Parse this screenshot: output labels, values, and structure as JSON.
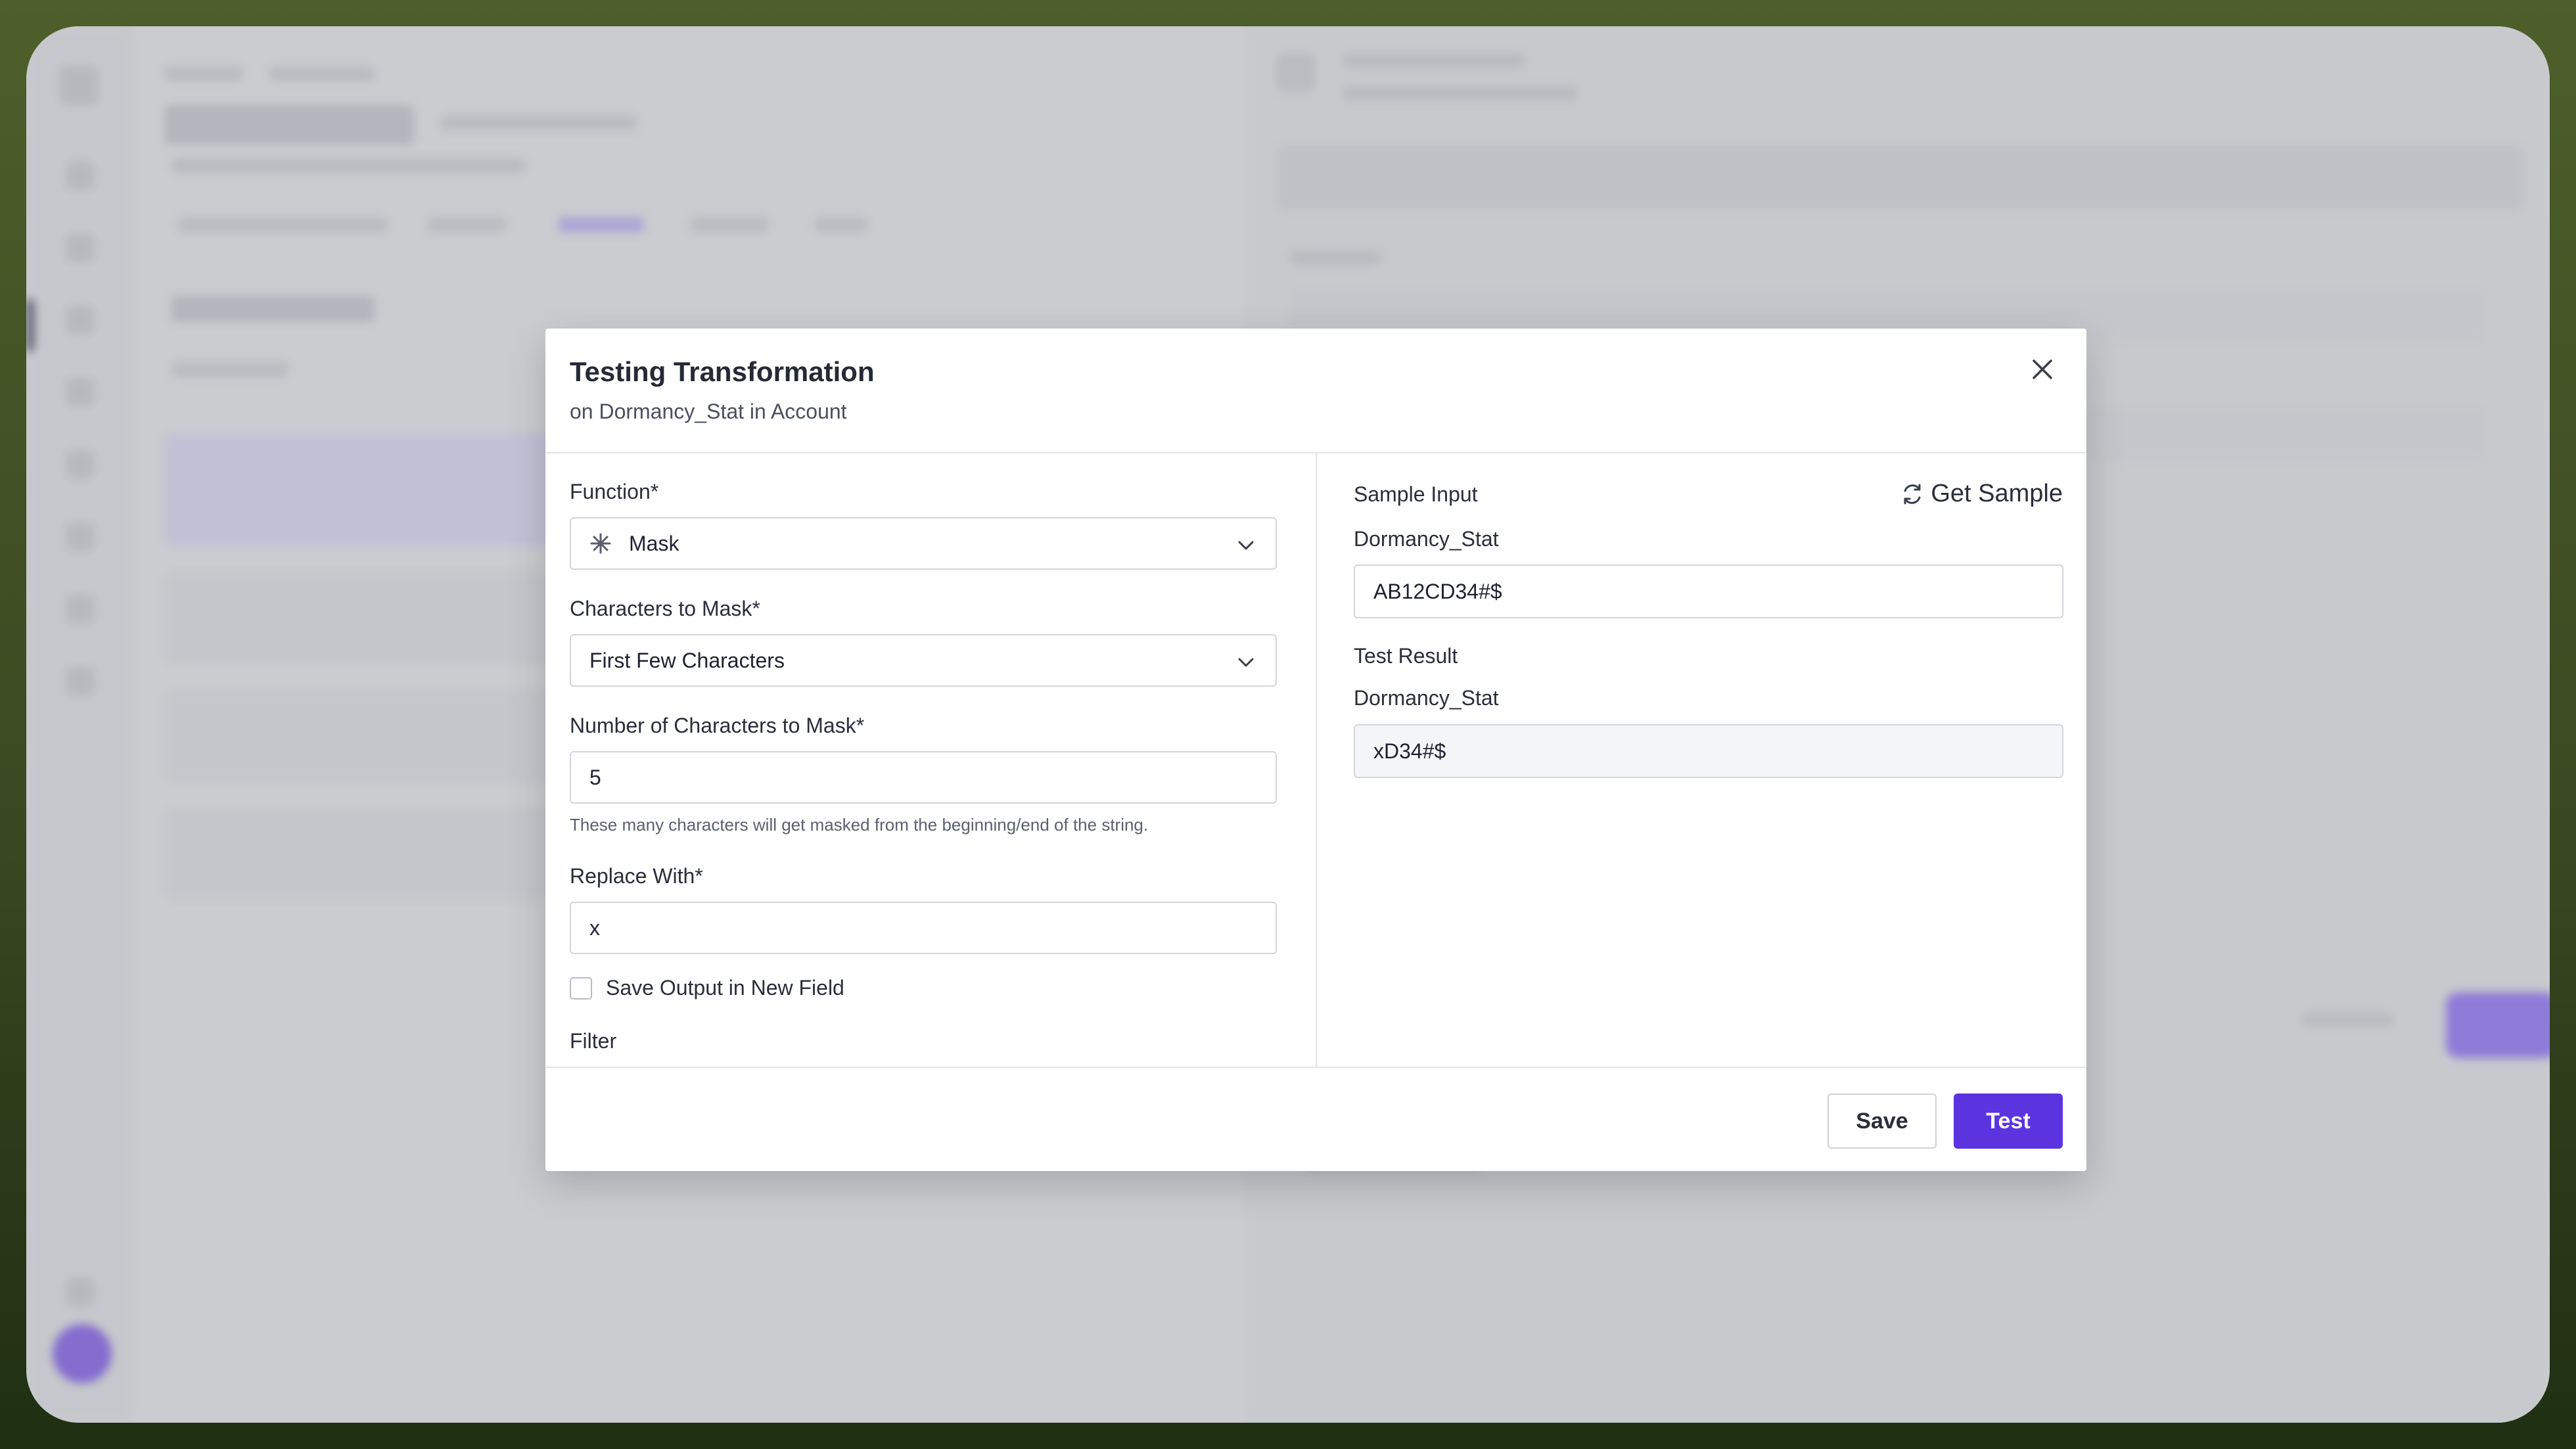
{
  "modal": {
    "title": "Testing Transformation",
    "subtitle": "on Dormancy_Stat in Account",
    "left": {
      "function_label": "Function*",
      "function_value": "Mask",
      "function_icon": "asterisk-icon",
      "chars_to_mask_label": "Characters to Mask*",
      "chars_to_mask_value": "First Few Characters",
      "num_chars_label": "Number of Characters to Mask*",
      "num_chars_value": "5",
      "num_chars_helper": "These many characters will get masked from the beginning/end of the string.",
      "replace_with_label": "Replace With*",
      "replace_with_value": "x",
      "save_output_label": "Save Output in New Field",
      "save_output_checked": false,
      "filter_label": "Filter"
    },
    "right": {
      "sample_input_label": "Sample Input",
      "get_sample_label": "Get Sample",
      "sample_field_label": "Dormancy_Stat",
      "sample_field_value": "AB12CD34#$",
      "test_result_label": "Test Result",
      "result_field_label": "Dormancy_Stat",
      "result_field_value": "xD34#$"
    },
    "footer": {
      "save_label": "Save",
      "test_label": "Test"
    }
  },
  "colors": {
    "accent": "#5b34e0",
    "overlay_background": "#d4d5d8",
    "outer_background": "#3a4a22"
  }
}
